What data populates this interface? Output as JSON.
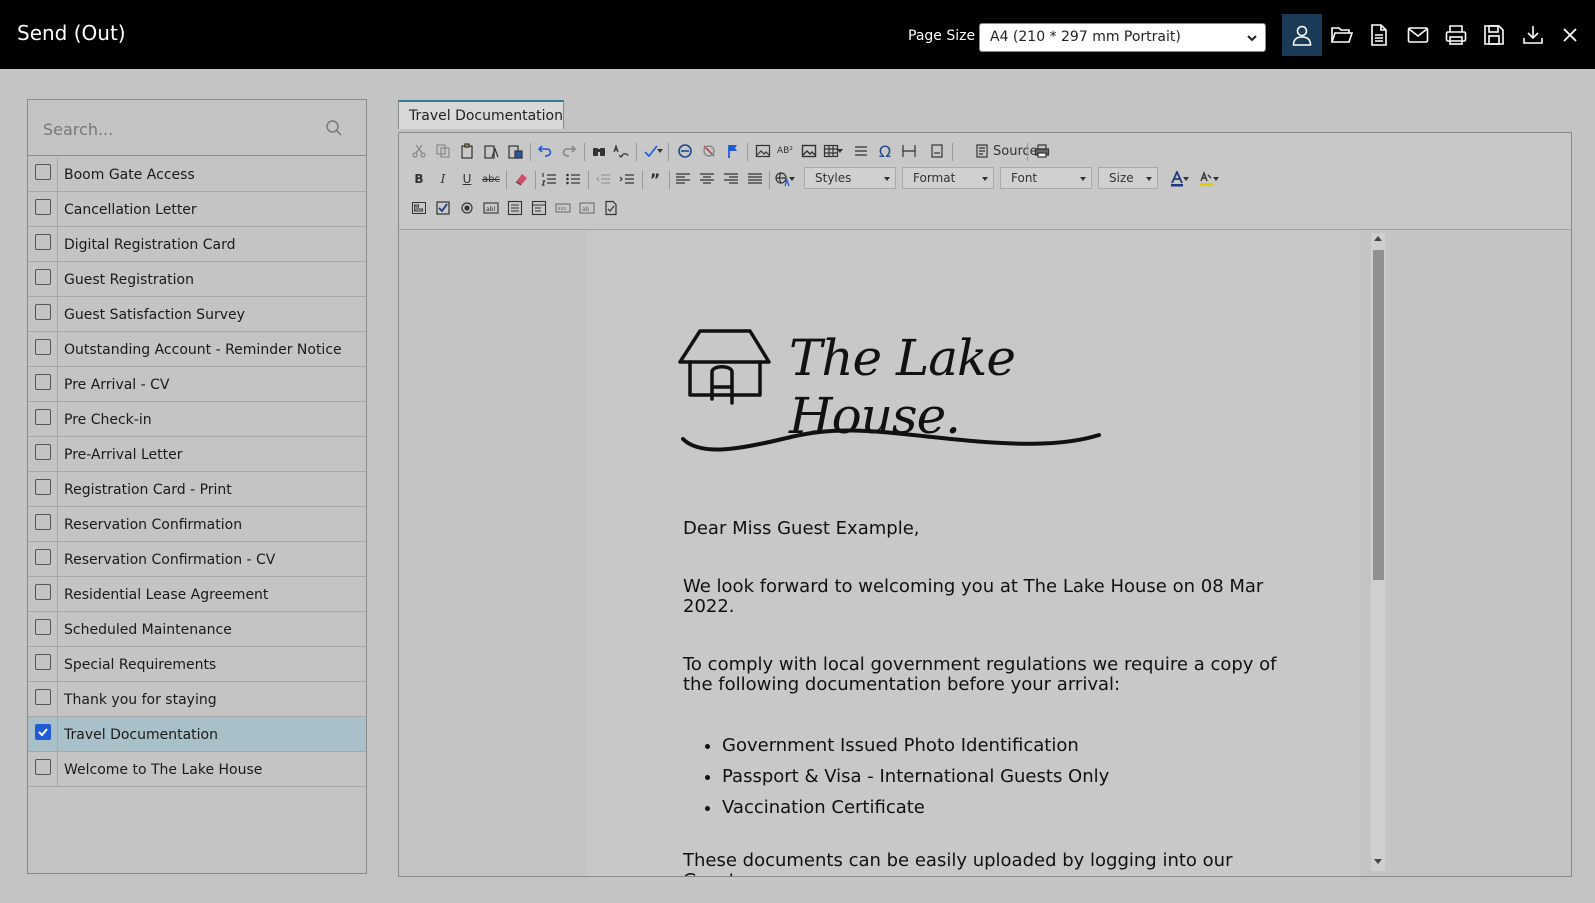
{
  "header": {
    "title": "Send (Out)",
    "page_size_label": "Page Size",
    "page_size_value": "A4 (210 * 297 mm Portrait)",
    "actions": [
      "user-icon",
      "folder-open-icon",
      "document-icon",
      "mail-icon",
      "print-icon",
      "save-icon",
      "download-icon",
      "close-icon"
    ]
  },
  "search": {
    "placeholder": "Search..."
  },
  "documents": [
    {
      "label": "Boom Gate Access",
      "checked": false
    },
    {
      "label": "Cancellation Letter",
      "checked": false
    },
    {
      "label": "Digital Registration Card",
      "checked": false
    },
    {
      "label": "Guest Registration",
      "checked": false
    },
    {
      "label": "Guest Satisfaction Survey",
      "checked": false
    },
    {
      "label": "Outstanding Account - Reminder Notice",
      "checked": false
    },
    {
      "label": "Pre Arrival - CV",
      "checked": false
    },
    {
      "label": "Pre Check-in",
      "checked": false
    },
    {
      "label": "Pre-Arrival Letter",
      "checked": false
    },
    {
      "label": "Registration Card - Print",
      "checked": false
    },
    {
      "label": "Reservation Confirmation",
      "checked": false
    },
    {
      "label": "Reservation Confirmation - CV",
      "checked": false
    },
    {
      "label": "Residential Lease Agreement",
      "checked": false
    },
    {
      "label": "Scheduled Maintenance",
      "checked": false
    },
    {
      "label": "Special Requirements",
      "checked": false
    },
    {
      "label": "Thank you for staying",
      "checked": false
    },
    {
      "label": "Travel Documentation",
      "checked": true
    },
    {
      "label": "Welcome to The Lake House",
      "checked": false
    }
  ],
  "editor": {
    "tab_label": "Travel Documentation",
    "toolbar": {
      "source_label": "Source",
      "styles_label": "Styles",
      "format_label": "Format",
      "font_label": "Font",
      "size_label": "Size",
      "bold": "B",
      "italic": "I",
      "underline": "U",
      "strike": "abc"
    },
    "letter": {
      "logo_text": "The Lake House.",
      "greeting": "Dear Miss Guest Example,",
      "para1_line1": "We look forward to welcoming you at The Lake House on 08 Mar",
      "para1_line2": "2022.",
      "para2_line1": "To comply with local government regulations we require a copy of",
      "para2_line2": "the following documentation before your arrival:",
      "bullets": [
        "Government Issued Photo Identification",
        "Passport & Visa - International Guests Only",
        "Vaccination Certificate"
      ],
      "para3_line1": "These documents can be easily uploaded by logging into our Guest"
    }
  },
  "colors": {
    "topbar": "#000000",
    "active_button": "#1a3a57",
    "selected_row": "#a9c0c8",
    "checkbox_checked": "#1f5bd6",
    "background": "#c4c4c4"
  }
}
